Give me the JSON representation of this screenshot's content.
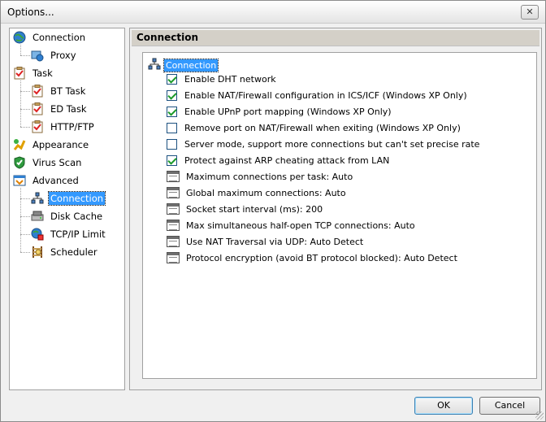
{
  "window": {
    "title": "Options...",
    "close_symbol": "✕"
  },
  "tree": {
    "items": [
      {
        "label": "Connection",
        "icon": "globe-icon",
        "level": 0,
        "selected": false
      },
      {
        "label": "Proxy",
        "icon": "proxy-icon",
        "level": 1,
        "selected": false
      },
      {
        "label": "Task",
        "icon": "task-icon",
        "level": 0,
        "selected": false
      },
      {
        "label": "BT Task",
        "icon": "task-icon",
        "level": 1,
        "selected": false
      },
      {
        "label": "ED Task",
        "icon": "task-icon",
        "level": 1,
        "selected": false
      },
      {
        "label": "HTTP/FTP",
        "icon": "task-icon",
        "level": 1,
        "selected": false
      },
      {
        "label": "Appearance",
        "icon": "appearance-icon",
        "level": 0,
        "selected": false
      },
      {
        "label": "Virus Scan",
        "icon": "shield-icon",
        "level": 0,
        "selected": false
      },
      {
        "label": "Advanced",
        "icon": "advanced-icon",
        "level": 0,
        "selected": false
      },
      {
        "label": "Connection",
        "icon": "network-icon",
        "level": 1,
        "selected": true
      },
      {
        "label": "Disk Cache",
        "icon": "disk-icon",
        "level": 1,
        "selected": false
      },
      {
        "label": "TCP/IP Limit",
        "icon": "tcpip-icon",
        "level": 1,
        "selected": false
      },
      {
        "label": "Scheduler",
        "icon": "scheduler-icon",
        "level": 1,
        "selected": false
      }
    ]
  },
  "panel": {
    "header": "Connection",
    "root_label": "Connection",
    "options": [
      {
        "type": "checkbox",
        "checked": true,
        "label": "Enable DHT network"
      },
      {
        "type": "checkbox",
        "checked": true,
        "label": "Enable NAT/Firewall configuration in ICS/ICF (Windows XP Only)"
      },
      {
        "type": "checkbox",
        "checked": true,
        "label": "Enable UPnP port mapping (Windows XP Only)"
      },
      {
        "type": "checkbox",
        "checked": false,
        "label": "Remove port on NAT/Firewall when exiting (Windows XP Only)"
      },
      {
        "type": "checkbox",
        "checked": false,
        "label": "Server mode, support more connections but can't set precise rate"
      },
      {
        "type": "checkbox",
        "checked": true,
        "label": "Protect against ARP cheating attack from LAN"
      },
      {
        "type": "list",
        "label": "Maximum connections per task: Auto"
      },
      {
        "type": "list",
        "label": "Global maximum connections: Auto"
      },
      {
        "type": "list",
        "label": "Socket start interval (ms): 200"
      },
      {
        "type": "list",
        "label": "Max simultaneous half-open TCP connections: Auto"
      },
      {
        "type": "list",
        "label": "Use NAT Traversal via UDP: Auto Detect"
      },
      {
        "type": "list",
        "label": "Protocol encryption (avoid BT protocol blocked): Auto Detect"
      }
    ]
  },
  "buttons": {
    "ok": "OK",
    "cancel": "Cancel"
  },
  "colors": {
    "selection": "#3399ff",
    "check": "#1b9a2a"
  }
}
